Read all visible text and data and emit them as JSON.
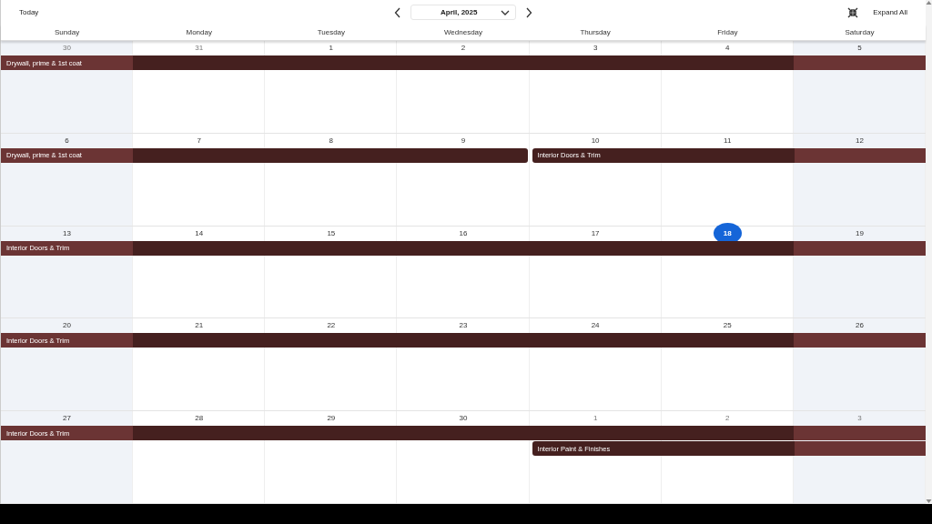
{
  "toolbar": {
    "today_button": "Today",
    "month": "April, 2025",
    "expand_button": "Expand All"
  },
  "weekdays": [
    "Sunday",
    "Monday",
    "Tuesday",
    "Wednesday",
    "Thursday",
    "Friday",
    "Saturday"
  ],
  "weeks": [
    {
      "days": [
        {
          "label": "30",
          "muted": true,
          "today": false
        },
        {
          "label": "31",
          "muted": true,
          "today": false
        },
        {
          "label": "1",
          "muted": false,
          "today": false
        },
        {
          "label": "2",
          "muted": false,
          "today": false
        },
        {
          "label": "3",
          "muted": false,
          "today": false
        },
        {
          "label": "4",
          "muted": false,
          "today": false
        },
        {
          "label": "5",
          "muted": false,
          "today": false
        }
      ],
      "lanes": [
        [
          {
            "kind": "start",
            "title": "Drywall, prime & 1st coat"
          },
          {
            "kind": "continue"
          },
          {
            "kind": "continue"
          },
          {
            "kind": "continue"
          },
          {
            "kind": "continue"
          },
          {
            "kind": "continue"
          },
          {
            "kind": "continue"
          }
        ]
      ]
    },
    {
      "days": [
        {
          "label": "6",
          "muted": false,
          "today": false
        },
        {
          "label": "7",
          "muted": false,
          "today": false
        },
        {
          "label": "8",
          "muted": false,
          "today": false
        },
        {
          "label": "9",
          "muted": false,
          "today": false
        },
        {
          "label": "10",
          "muted": false,
          "today": false
        },
        {
          "label": "11",
          "muted": false,
          "today": false
        },
        {
          "label": "12",
          "muted": false,
          "today": false
        }
      ],
      "lanes": [
        [
          {
            "kind": "start",
            "title": "Drywall, prime & 1st coat"
          },
          {
            "kind": "continue"
          },
          {
            "kind": "continue"
          },
          {
            "kind": "continue"
          },
          {
            "kind": "start",
            "title": "Interior Doors & Trim"
          },
          {
            "kind": "continue"
          },
          {
            "kind": "continue"
          }
        ]
      ]
    },
    {
      "days": [
        {
          "label": "13",
          "muted": false,
          "today": false
        },
        {
          "label": "14",
          "muted": false,
          "today": false
        },
        {
          "label": "15",
          "muted": false,
          "today": false
        },
        {
          "label": "16",
          "muted": false,
          "today": false
        },
        {
          "label": "17",
          "muted": false,
          "today": false
        },
        {
          "label": "18",
          "muted": false,
          "today": true
        },
        {
          "label": "19",
          "muted": false,
          "today": false
        }
      ],
      "lanes": [
        [
          {
            "kind": "start",
            "title": "Interior Doors & Trim"
          },
          {
            "kind": "continue"
          },
          {
            "kind": "continue"
          },
          {
            "kind": "continue"
          },
          {
            "kind": "continue"
          },
          {
            "kind": "continue"
          },
          {
            "kind": "continue"
          }
        ]
      ]
    },
    {
      "days": [
        {
          "label": "20",
          "muted": false,
          "today": false
        },
        {
          "label": "21",
          "muted": false,
          "today": false
        },
        {
          "label": "22",
          "muted": false,
          "today": false
        },
        {
          "label": "23",
          "muted": false,
          "today": false
        },
        {
          "label": "24",
          "muted": false,
          "today": false
        },
        {
          "label": "25",
          "muted": false,
          "today": false
        },
        {
          "label": "26",
          "muted": false,
          "today": false
        }
      ],
      "lanes": [
        [
          {
            "kind": "start",
            "title": "Interior Doors & Trim"
          },
          {
            "kind": "continue"
          },
          {
            "kind": "continue"
          },
          {
            "kind": "continue"
          },
          {
            "kind": "continue"
          },
          {
            "kind": "continue"
          },
          {
            "kind": "continue"
          }
        ]
      ]
    },
    {
      "days": [
        {
          "label": "27",
          "muted": false,
          "today": false
        },
        {
          "label": "28",
          "muted": false,
          "today": false
        },
        {
          "label": "29",
          "muted": false,
          "today": false
        },
        {
          "label": "30",
          "muted": false,
          "today": false
        },
        {
          "label": "1",
          "muted": true,
          "today": false
        },
        {
          "label": "2",
          "muted": true,
          "today": false
        },
        {
          "label": "3",
          "muted": true,
          "today": false
        }
      ],
      "lanes": [
        [
          {
            "kind": "start",
            "title": "Interior Doors & Trim"
          },
          {
            "kind": "continue"
          },
          {
            "kind": "continue"
          },
          {
            "kind": "continue"
          },
          {
            "kind": "continue"
          },
          {
            "kind": "continue"
          },
          {
            "kind": "continue"
          }
        ],
        [
          {
            "kind": "empty"
          },
          {
            "kind": "empty"
          },
          {
            "kind": "empty"
          },
          {
            "kind": "empty"
          },
          {
            "kind": "start",
            "title": "Interior Paint & Finishes"
          },
          {
            "kind": "continue"
          },
          {
            "kind": "continue"
          }
        ]
      ]
    }
  ]
}
